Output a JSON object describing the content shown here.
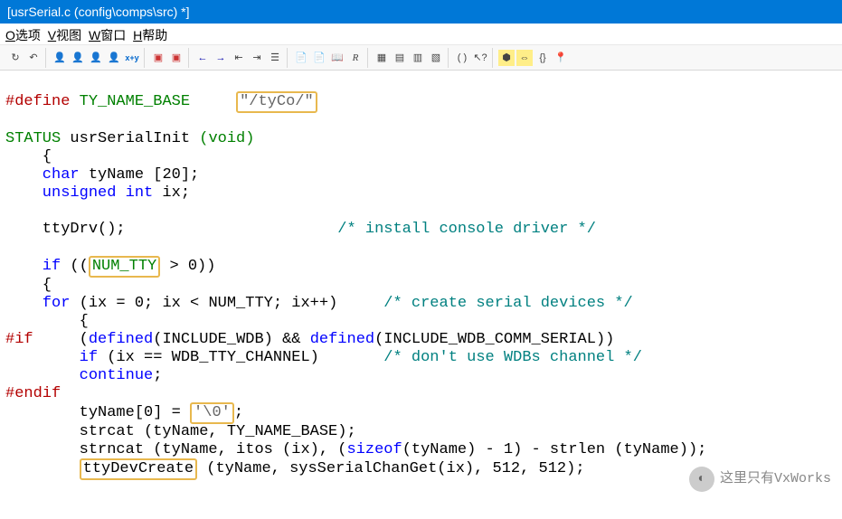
{
  "window": {
    "title": "[usrSerial.c (config\\comps\\src) *]"
  },
  "menu": {
    "options": "O选项",
    "view": "V视图",
    "window": "W窗口",
    "help": "H帮助"
  },
  "toolbar_icons": [
    "reload",
    "undo",
    "find-person",
    "find-prev",
    "find-next",
    "find-all",
    "regex",
    "bookmark-prev",
    "bookmark-next",
    "arrow-left",
    "arrow-right",
    "outdent",
    "indent",
    "list",
    "doc1",
    "doc2",
    "book",
    "script",
    "tile1",
    "tile2",
    "tile3",
    "tile4",
    "paren",
    "help-pointer",
    "hex",
    "expand",
    "bracket",
    "location"
  ],
  "code": {
    "l1_define": "#define ",
    "l1_name": "TY_NAME_BASE",
    "l1_str": "\"/tyCo/\"",
    "l3_type": "STATUS",
    "l3_func": " usrSerialInit ",
    "l3_void": "(void)",
    "l4_brace": "    {",
    "l5_char": "    char",
    "l5_rest": " tyName [20];",
    "l6_uint": "    unsigned int",
    "l6_rest": " ix;",
    "l8_call": "    ttyDrv();",
    "l8_cmt": "/* install console driver */",
    "l10_if": "    if",
    "l10_open": " ((",
    "l10_numtty": "NUM_TTY",
    "l10_rest": " > 0))",
    "l11_brace": "    {",
    "l12_for": "    for",
    "l12_body": " (ix = 0; ix < NUM_TTY; ix++)",
    "l12_cmt": "/* create serial devices */",
    "l13_brace": "        {",
    "l14_pif": "#if",
    "l14_d1": "defined",
    "l14_a1": "(INCLUDE_WDB)",
    "l14_amp": " && ",
    "l14_d2": "defined",
    "l14_a2": "(INCLUDE_WDB_COMM_SERIAL))",
    "l15_if": "        if",
    "l15_rest": " (ix == WDB_TTY_CHANNEL)",
    "l15_cmt": "/* don't use WDBs channel */",
    "l16_cont": "        continue",
    "l16_semi": ";",
    "l17_pendif": "#endif",
    "l18_assign_l": "        tyName[0] = ",
    "l18_char": "'\\0'",
    "l18_semi": ";",
    "l19_strcat": "        strcat (tyName, TY_NAME_BASE);",
    "l20_strncat_a": "        strncat (tyName, itos (ix), (",
    "l20_sizeof": "sizeof",
    "l20_strncat_b": "(tyName) - 1) - strlen (tyName));",
    "l21_call": "ttyDevCreate",
    "l21_rest": " (tyName, sysSerialChanGet(ix), 512, 512);"
  },
  "watermark": {
    "text": "这里只有VxWorks"
  }
}
